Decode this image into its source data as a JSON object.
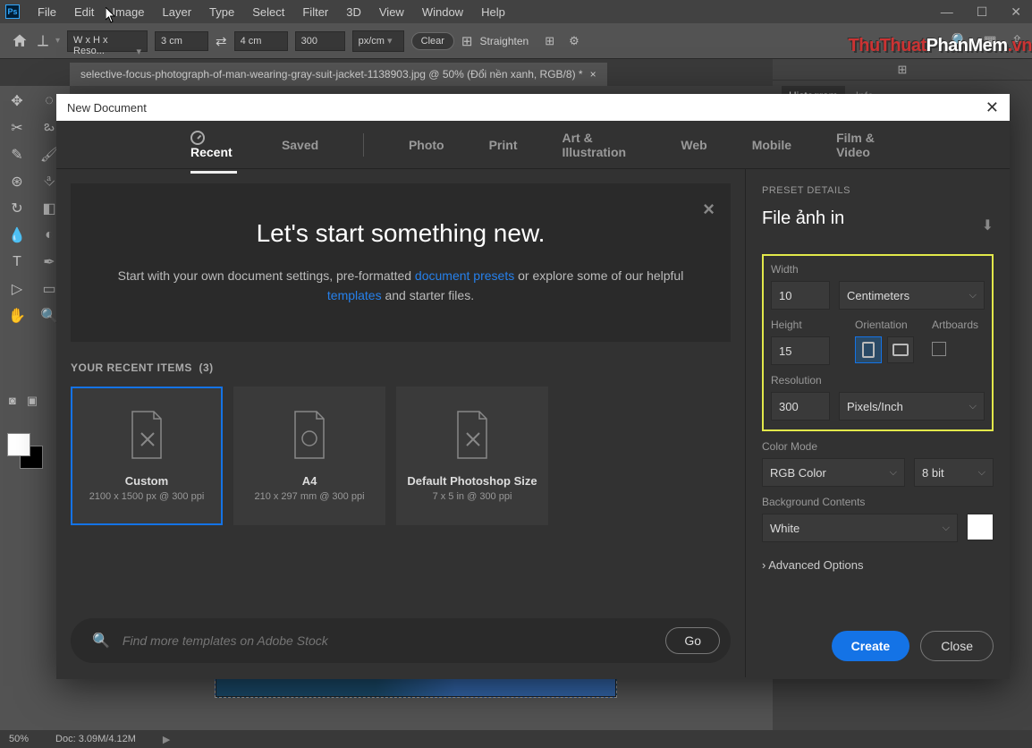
{
  "menubar": [
    "File",
    "Edit",
    "Image",
    "Layer",
    "Type",
    "Select",
    "Filter",
    "3D",
    "View",
    "Window",
    "Help"
  ],
  "options": {
    "ratio_label": "W x H x Reso...",
    "width": "3 cm",
    "height": "4 cm",
    "res": "300",
    "unit": "px/cm",
    "clear": "Clear",
    "straighten": "Straighten"
  },
  "doc_tab": "selective-focus-photograph-of-man-wearing-gray-suit-jacket-1138903.jpg @ 50% (Đổi nền xanh, RGB/8) *",
  "right_panel_tabs": [
    "Histogram",
    "Info"
  ],
  "watermark": {
    "a": "ThuThuat",
    "b": "PhanMem",
    "c": ".vn"
  },
  "status": {
    "zoom": "50%",
    "doc": "Doc: 3.09M/4.12M"
  },
  "dialog": {
    "title": "New Document",
    "tabs": [
      "Recent",
      "Saved",
      "Photo",
      "Print",
      "Art & Illustration",
      "Web",
      "Mobile",
      "Film & Video"
    ],
    "hero_h": "Let's start something new.",
    "hero_p1": "Start with your own document settings, pre-formatted ",
    "hero_link1": "document presets",
    "hero_p2": " or explore some of our helpful ",
    "hero_link2": "templates",
    "hero_p3": " and starter files.",
    "recent_hdr": "YOUR RECENT ITEMS",
    "recent_count": "(3)",
    "presets": [
      {
        "name": "Custom",
        "sub": "2100 x 1500 px @ 300 ppi"
      },
      {
        "name": "A4",
        "sub": "210 x 297 mm @ 300 ppi"
      },
      {
        "name": "Default Photoshop Size",
        "sub": "7 x 5 in @ 300 ppi"
      }
    ],
    "search_ph": "Find more templates on Adobe Stock",
    "go": "Go",
    "details": {
      "hdr": "PRESET DETAILS",
      "name": "File ảnh in",
      "width_lbl": "Width",
      "width": "10",
      "width_unit": "Centimeters",
      "height_lbl": "Height",
      "height": "15",
      "orient_lbl": "Orientation",
      "art_lbl": "Artboards",
      "res_lbl": "Resolution",
      "res": "300",
      "res_unit": "Pixels/Inch",
      "cmode_lbl": "Color Mode",
      "cmode": "RGB Color",
      "cdepth": "8 bit",
      "bg_lbl": "Background Contents",
      "bg": "White",
      "adv": "Advanced Options",
      "create": "Create",
      "close": "Close"
    }
  }
}
